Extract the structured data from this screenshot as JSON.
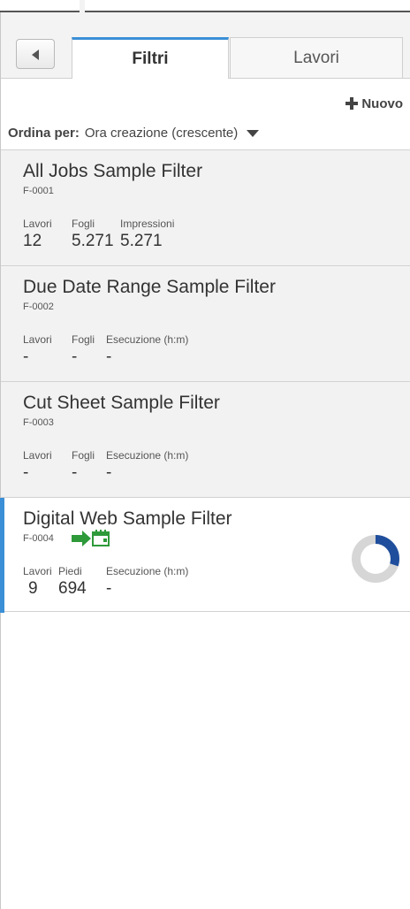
{
  "tabs": {
    "filters_label": "Filtri",
    "jobs_label": "Lavori"
  },
  "toolbar": {
    "new_label": "Nuovo"
  },
  "sort": {
    "label": "Ordina per:",
    "value": "Ora creazione (crescente)"
  },
  "filters": [
    {
      "name": "All Jobs Sample Filter",
      "code": "F-0001",
      "stats": [
        {
          "header": "Lavori",
          "value": "12"
        },
        {
          "header": "Fogli",
          "value": "5.271"
        },
        {
          "header": "Impressioni",
          "value": "5.271"
        }
      ]
    },
    {
      "name": "Due Date Range Sample Filter",
      "code": "F-0002",
      "stats": [
        {
          "header": "Lavori",
          "value": "-"
        },
        {
          "header": "Fogli",
          "value": "-"
        },
        {
          "header": "Esecuzione (h:m)",
          "value": "-"
        }
      ]
    },
    {
      "name": "Cut Sheet Sample Filter",
      "code": "F-0003",
      "stats": [
        {
          "header": "Lavori",
          "value": "-"
        },
        {
          "header": "Fogli",
          "value": "-"
        },
        {
          "header": "Esecuzione (h:m)",
          "value": "-"
        }
      ]
    },
    {
      "name": "Digital Web Sample Filter",
      "code": "F-0004",
      "status_icon": "job-transfer-icon",
      "progress_fraction": 0.3,
      "stats": [
        {
          "header": "Lavori",
          "value": "9"
        },
        {
          "header": "Piedi",
          "value": "694"
        },
        {
          "header": "Esecuzione (h:m)",
          "value": "-"
        }
      ]
    }
  ],
  "colors": {
    "accent": "#3b8fd6",
    "progress": "#1f4e9c",
    "icon_green": "#2e9a3a"
  }
}
